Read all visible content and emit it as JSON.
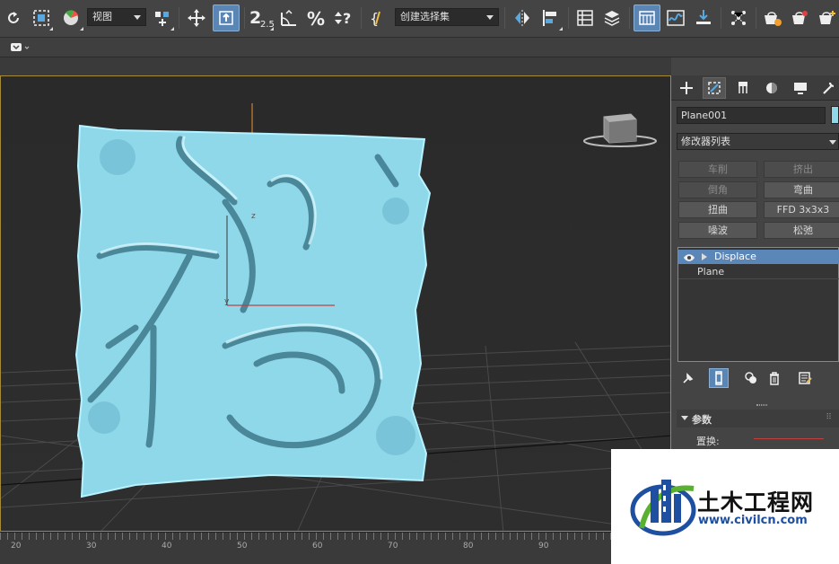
{
  "toolbar": {
    "view_dropdown": "视图",
    "selection_set_dropdown": "创建选择集",
    "snap_label": "2.5"
  },
  "command_panel": {
    "object_name": "Plane001",
    "modifier_list": "修改器列表",
    "buttons": [
      {
        "label": "车削",
        "enabled": false
      },
      {
        "label": "挤出",
        "enabled": false
      },
      {
        "label": "倒角",
        "enabled": false
      },
      {
        "label": "弯曲",
        "enabled": true
      },
      {
        "label": "扭曲",
        "enabled": true
      },
      {
        "label": "FFD 3x3x3",
        "enabled": true
      },
      {
        "label": "噪波",
        "enabled": true
      },
      {
        "label": "松弛",
        "enabled": true
      }
    ],
    "stack": [
      {
        "label": "Displace",
        "selected": true
      },
      {
        "label": "Plane",
        "selected": false
      }
    ],
    "rollout_title": "参数",
    "displacement_label": "置换:"
  },
  "timeline": {
    "ticks": [
      "20",
      "30",
      "40",
      "50",
      "60",
      "70",
      "80",
      "90"
    ]
  },
  "viewport": {
    "axis_labels": [
      "z",
      "y"
    ]
  },
  "logo": {
    "name": "土木工程网",
    "url": "www.civilcn.com"
  },
  "colors": {
    "accent": "#5a86b5",
    "viewport_border": "#a48b3a",
    "mesh": "#8fd8ea",
    "logo_blue": "#1e4fa0",
    "logo_green": "#5ab030"
  }
}
